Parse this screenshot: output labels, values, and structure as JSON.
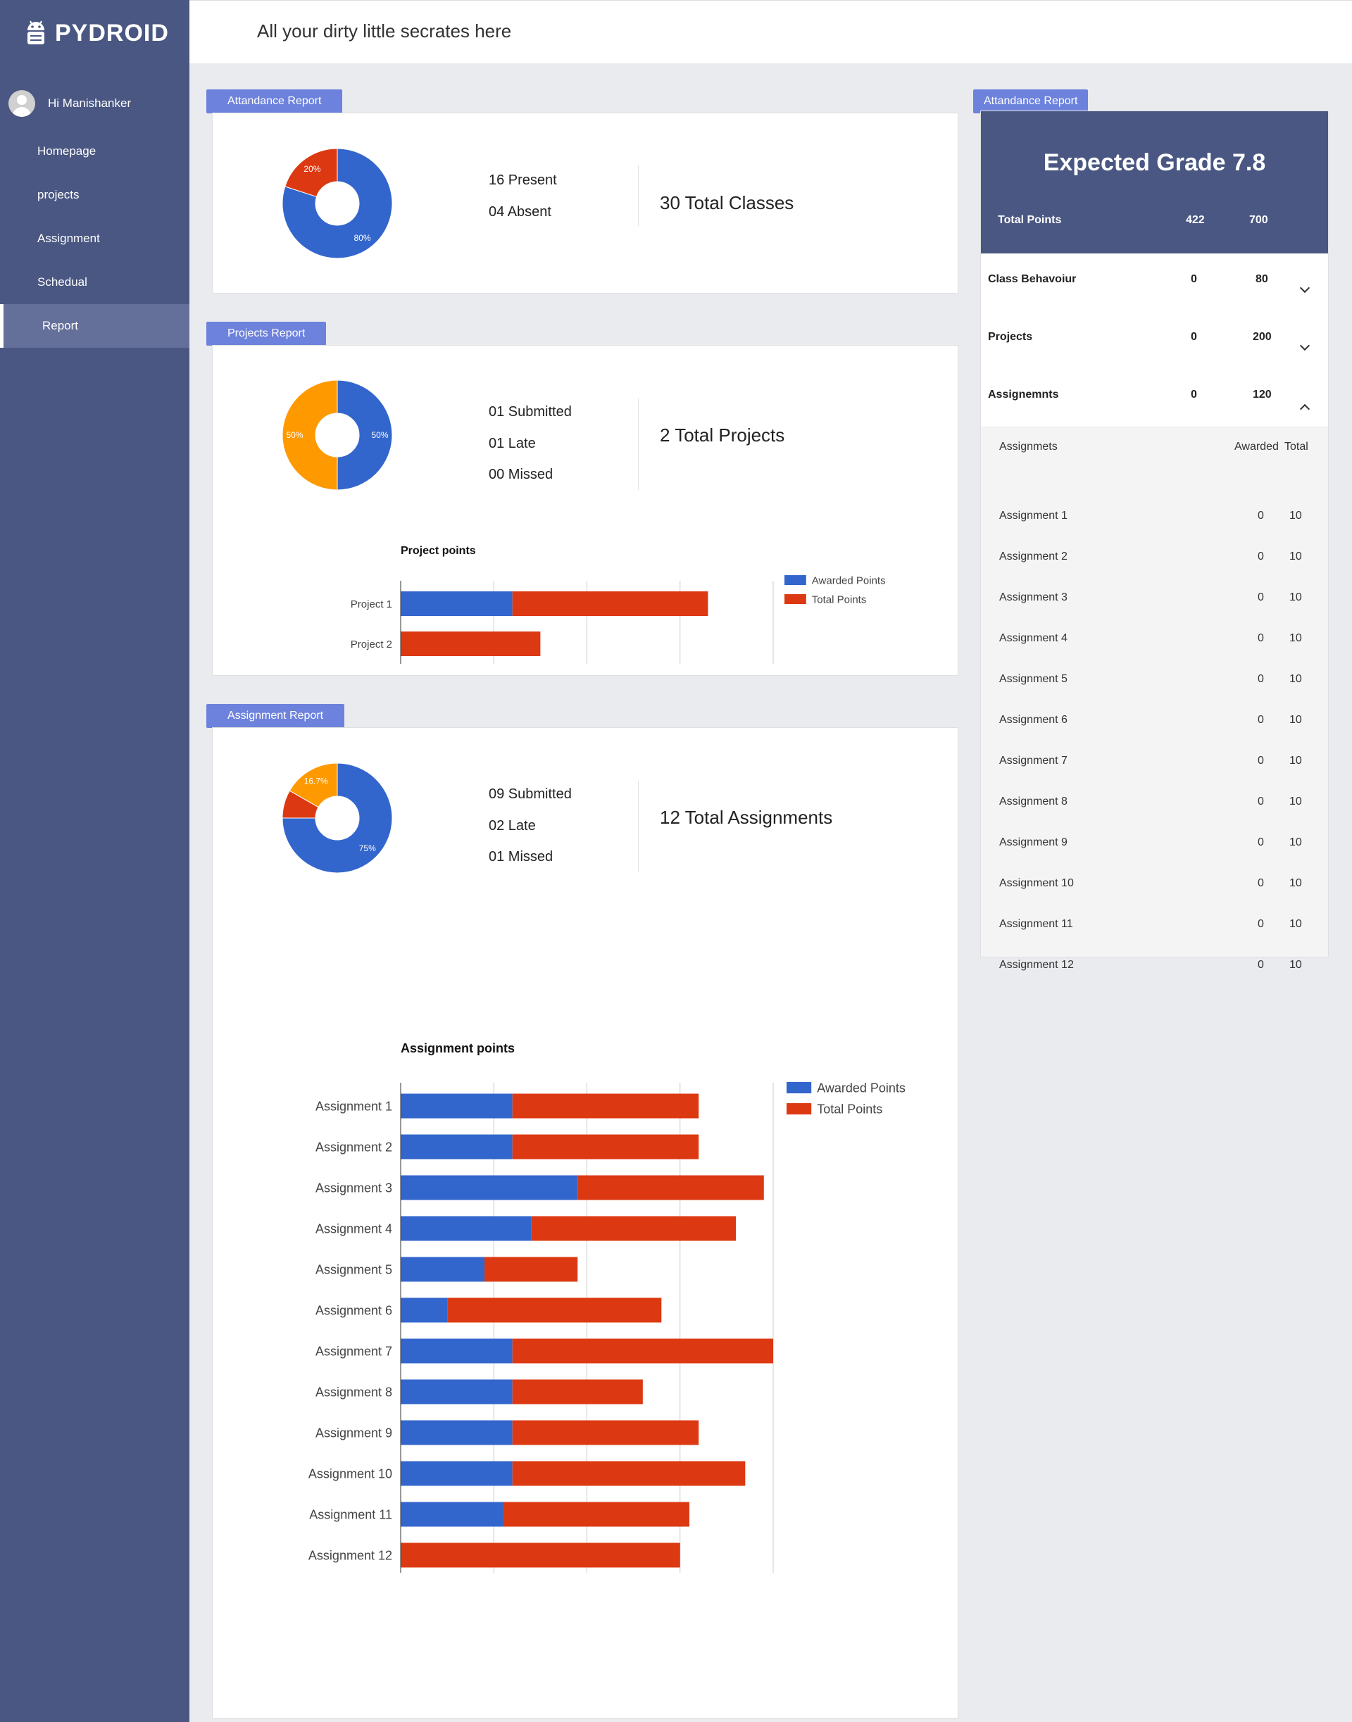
{
  "app": {
    "logo": "PYDROID",
    "top_title": "All your dirty little secrates here"
  },
  "user": {
    "greeting": "Hi Manishanker"
  },
  "nav": [
    "Homepage",
    "projects",
    "Assignment",
    "Schedual",
    "Report"
  ],
  "attendance": {
    "tag": "Attandance Report",
    "present": "16 Present",
    "absent": "04 Absent",
    "total": "30 Total Classes",
    "pie": [
      {
        "label": "80%",
        "value": 80,
        "color": "#3366cc"
      },
      {
        "label": "20%",
        "value": 20,
        "color": "#dc3912"
      }
    ]
  },
  "projects": {
    "tag": "Projects Report",
    "submitted": "01 Submitted",
    "late": "01 Late",
    "missed": "00 Missed",
    "total": "2 Total Projects",
    "pie": [
      {
        "label": "50%",
        "value": 50,
        "color": "#3366cc"
      },
      {
        "label": "50%",
        "value": 50,
        "color": "#ff9900"
      }
    ]
  },
  "assignments": {
    "tag": "Assignment Report",
    "submitted": "09 Submitted",
    "late": "02 Late",
    "missed": "01 Missed",
    "total": "12 Total Assignments",
    "pie": [
      {
        "label": "75%",
        "value": 75,
        "color": "#3366cc"
      },
      {
        "label": "",
        "value": 8.3,
        "color": "#dc3912"
      },
      {
        "label": "16.7%",
        "value": 16.7,
        "color": "#ff9900"
      }
    ]
  },
  "chart_data": [
    {
      "type": "bar",
      "title": "Project points",
      "categories": [
        "Project 1",
        "Project 2"
      ],
      "series": [
        {
          "name": "Awarded Points",
          "color": "#3366cc",
          "values": [
            120,
            0
          ]
        },
        {
          "name": "Total Points",
          "color": "#dc3912",
          "values": [
            210,
            150
          ]
        }
      ],
      "xlim": [
        0,
        400
      ],
      "ticks": [
        0,
        100,
        200,
        300,
        400
      ],
      "stacked": true,
      "grid": true,
      "legend": "right"
    },
    {
      "type": "bar",
      "title": "Assignment points",
      "categories": [
        "Assignment 1",
        "Assignment 2",
        "Assignment 3",
        "Assignment 4",
        "Assignment 5",
        "Assignment 6",
        "Assignment 7",
        "Assignment 8",
        "Assignment 9",
        "Assignment 10",
        "Assignment 11",
        "Assignment 12"
      ],
      "series": [
        {
          "name": "Awarded Points",
          "color": "#3366cc",
          "values": [
            12,
            12,
            19,
            14,
            9,
            5,
            12,
            12,
            12,
            12,
            11,
            0
          ]
        },
        {
          "name": "Total Points",
          "color": "#dc3912",
          "values": [
            20,
            20,
            20,
            22,
            10,
            23,
            28,
            14,
            20,
            25,
            20,
            30
          ]
        }
      ],
      "xlim": [
        0,
        40
      ],
      "ticks": [
        0,
        10,
        20,
        30,
        40
      ],
      "stacked": true,
      "grid": true,
      "legend": "right"
    }
  ],
  "grade": {
    "tag": "Attandance Report",
    "title": "Expected Grade 7.8",
    "total_label": "Total Points",
    "total_awarded": "422",
    "total_max": "700",
    "categories": [
      {
        "name": "Class Behavoiur",
        "awarded": "0",
        "total": "80"
      },
      {
        "name": "Projects",
        "awarded": "0",
        "total": "200"
      },
      {
        "name": "Assignemnts",
        "awarded": "0",
        "total": "120"
      }
    ],
    "sub_header": {
      "name": "Assignmets",
      "awarded": "Awarded",
      "total": "Total"
    },
    "items": [
      {
        "name": "Assignment 1",
        "awarded": "0",
        "total": "10"
      },
      {
        "name": "Assignment 2",
        "awarded": "0",
        "total": "10"
      },
      {
        "name": "Assignment 3",
        "awarded": "0",
        "total": "10"
      },
      {
        "name": "Assignment 4",
        "awarded": "0",
        "total": "10"
      },
      {
        "name": "Assignment 5",
        "awarded": "0",
        "total": "10"
      },
      {
        "name": "Assignment 6",
        "awarded": "0",
        "total": "10"
      },
      {
        "name": "Assignment 7",
        "awarded": "0",
        "total": "10"
      },
      {
        "name": "Assignment 8",
        "awarded": "0",
        "total": "10"
      },
      {
        "name": "Assignment 9",
        "awarded": "0",
        "total": "10"
      },
      {
        "name": "Assignment 10",
        "awarded": "0",
        "total": "10"
      },
      {
        "name": "Assignment 11",
        "awarded": "0",
        "total": "10"
      },
      {
        "name": "Assignment 12",
        "awarded": "0",
        "total": "10"
      }
    ]
  }
}
